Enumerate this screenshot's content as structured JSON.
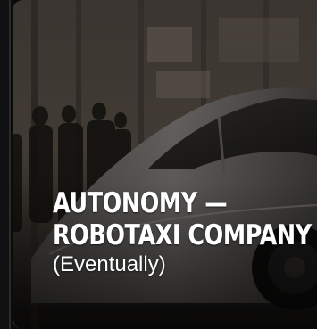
{
  "card": {
    "headline_line1": "AUTONOMY —",
    "headline_line2": "ROBOTAXI COMPANY",
    "subline": "(Eventually)"
  },
  "colors": {
    "text": "#ffffff",
    "scene_tone": "#2a2622"
  }
}
